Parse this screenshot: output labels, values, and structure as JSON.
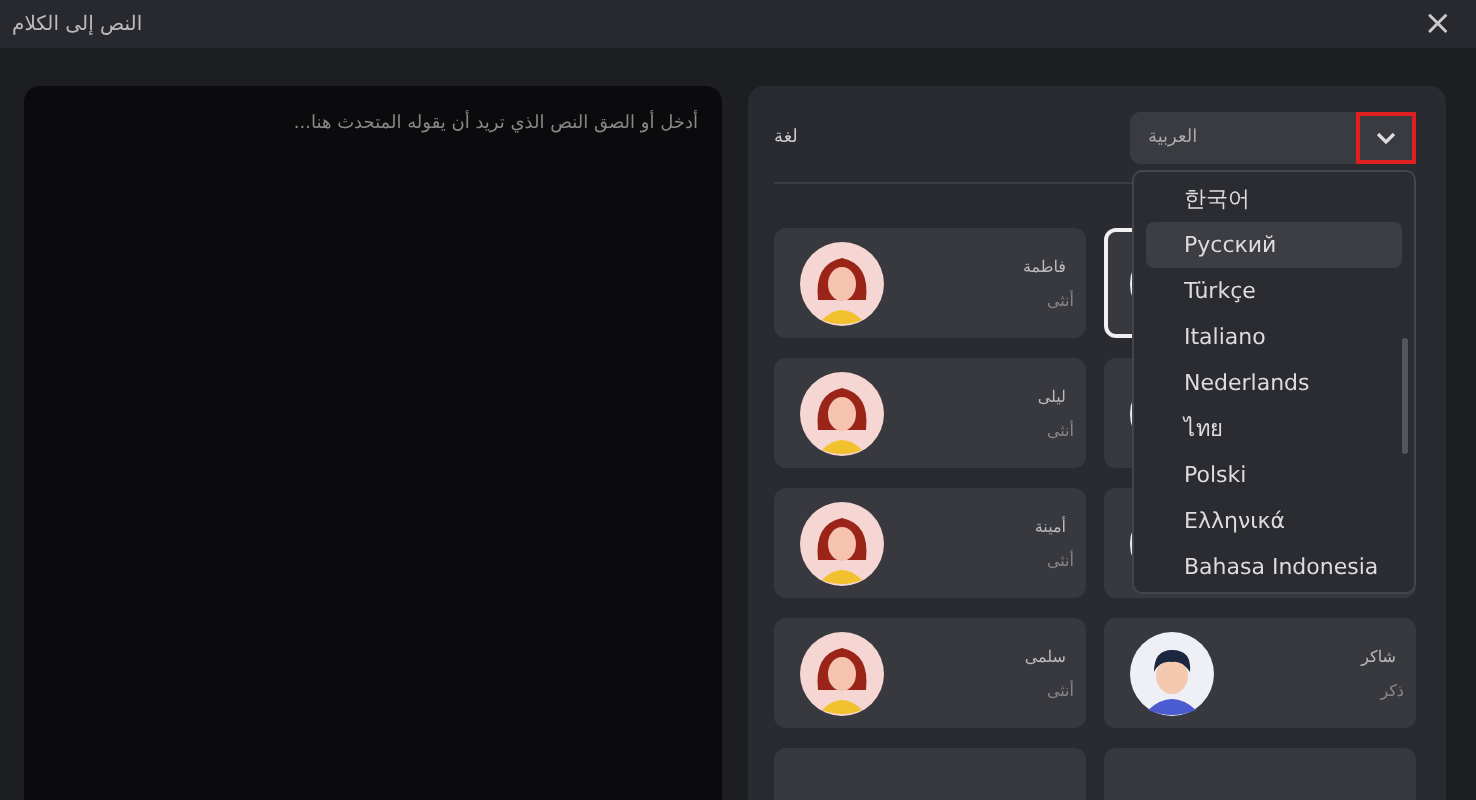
{
  "window": {
    "title": "النص إلى الكلام",
    "close": "×"
  },
  "text_input": {
    "placeholder": "أدخل أو الصق النص الذي تريد أن يقوله المتحدث هنا..."
  },
  "language": {
    "label": "لغة",
    "value": "العربية",
    "expanded": true,
    "options": [
      {
        "label": "한국어",
        "selected": false
      },
      {
        "label": "Русский",
        "selected": true
      },
      {
        "label": "Türkçe",
        "selected": false
      },
      {
        "label": "Italiano",
        "selected": false
      },
      {
        "label": "Nederlands",
        "selected": false
      },
      {
        "label": "ไทย",
        "selected": false
      },
      {
        "label": "Polski",
        "selected": false
      },
      {
        "label": "Ελληνικά",
        "selected": false
      },
      {
        "label": "Bahasa Indonesia",
        "selected": false
      }
    ]
  },
  "voices": [
    {
      "kind": "male",
      "selected": true
    },
    {
      "name": "فاطمة",
      "gender": "أنثى",
      "kind": "female",
      "selected": false
    },
    {
      "kind": "male",
      "selected": false
    },
    {
      "name": "ليلى",
      "gender": "أنثى",
      "kind": "female",
      "selected": false
    },
    {
      "kind": "male",
      "selected": false
    },
    {
      "name": "أمينة",
      "gender": "أنثى",
      "kind": "female",
      "selected": false
    },
    {
      "name": "شاكر",
      "gender": "ذكر",
      "kind": "male",
      "selected": false
    },
    {
      "name": "سلمى",
      "gender": "أنثى",
      "kind": "female",
      "selected": false
    },
    {
      "selected": false
    },
    {
      "selected": false
    }
  ]
}
